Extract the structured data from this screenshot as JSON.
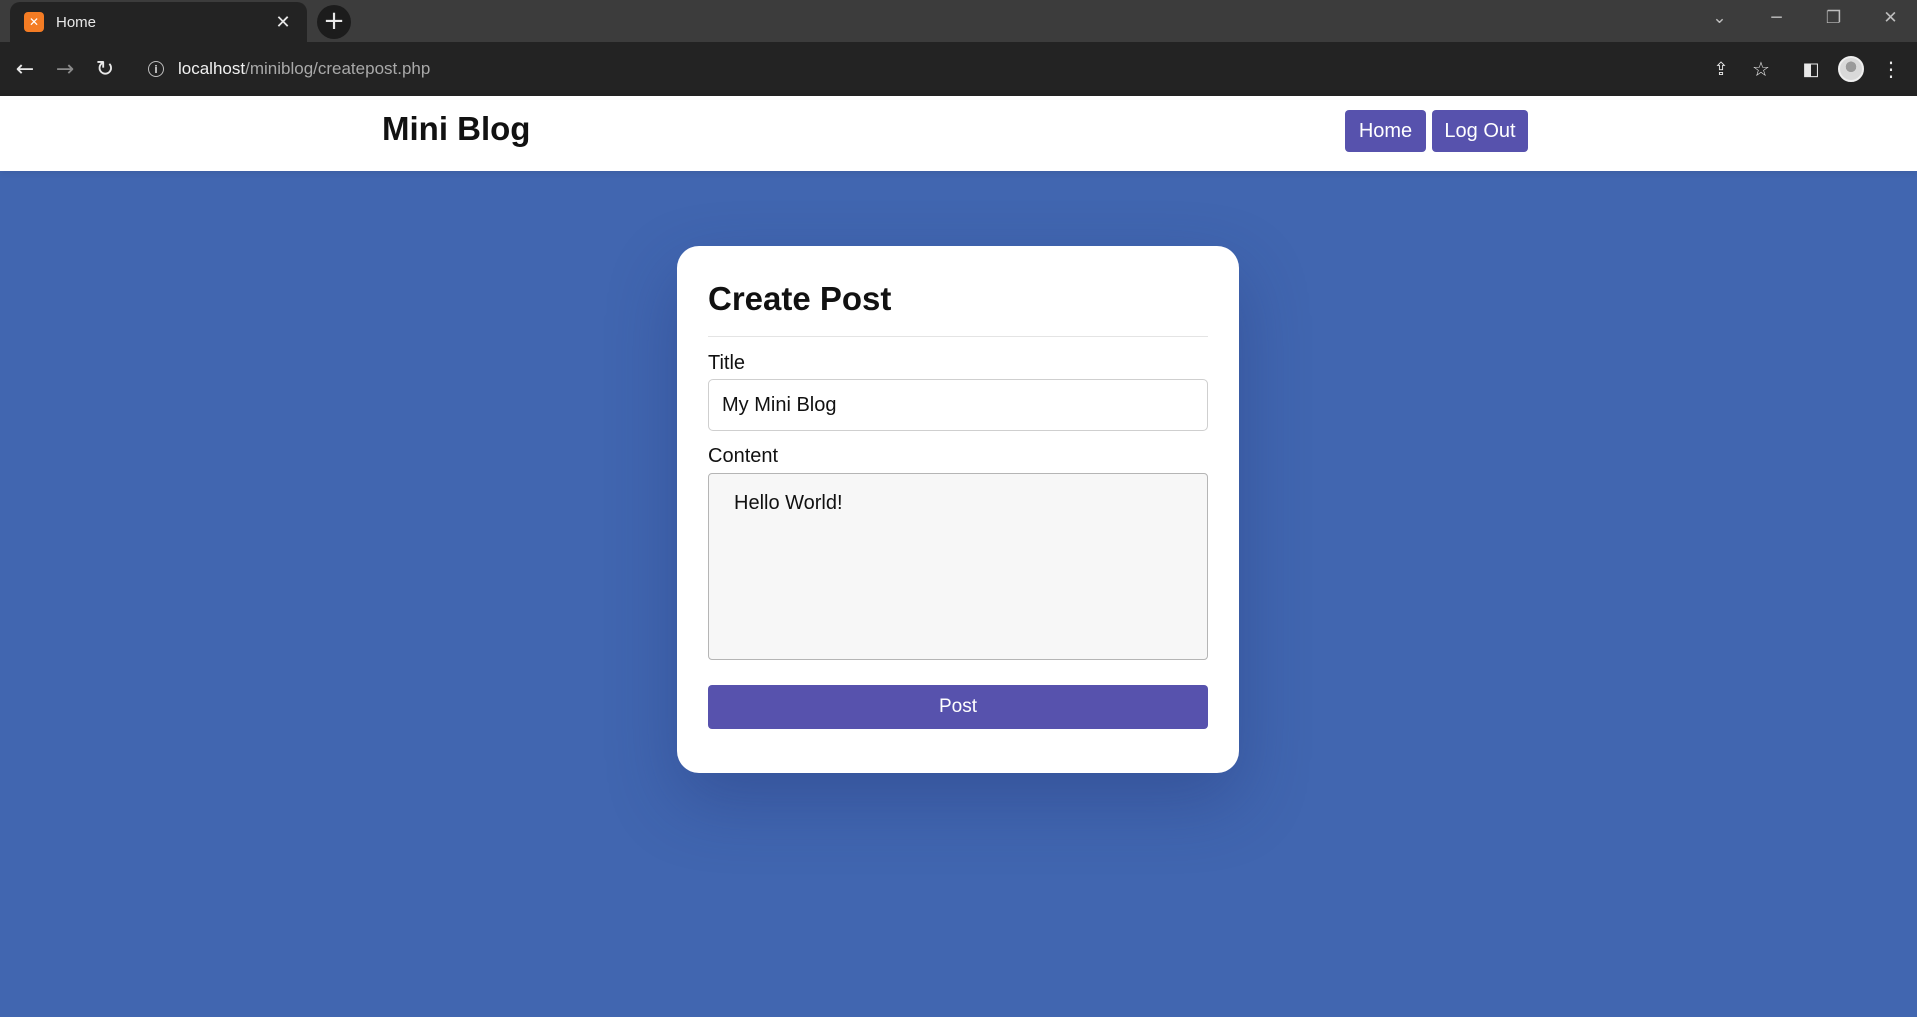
{
  "browser": {
    "tab": {
      "title": "Home",
      "favicon": "xampp-icon"
    },
    "url": {
      "host": "localhost",
      "path": "/miniblog/createpost.php"
    }
  },
  "navbar": {
    "brand": "Mini Blog",
    "home_label": "Home",
    "logout_label": "Log Out"
  },
  "form": {
    "heading": "Create Post",
    "title_label": "Title",
    "title_value": "My Mini Blog",
    "content_label": "Content",
    "content_value": "Hello World!",
    "submit_label": "Post"
  },
  "colors": {
    "page_background": "#4166b0",
    "accent": "#5752ad",
    "card_background": "#ffffff"
  }
}
